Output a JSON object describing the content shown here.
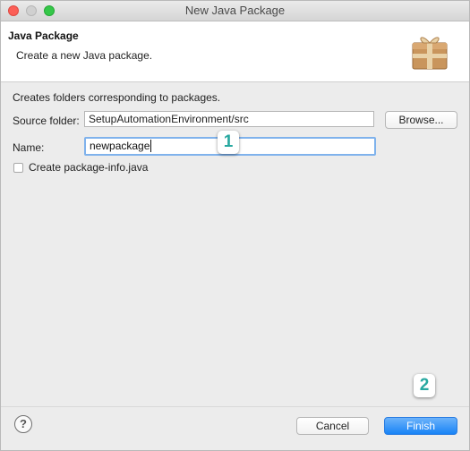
{
  "window": {
    "title": "New Java Package"
  },
  "header": {
    "title": "Java Package",
    "description": "Create a new Java package.",
    "icon": "package-icon"
  },
  "form": {
    "info": "Creates folders corresponding to packages.",
    "source_folder": {
      "label": "Source folder:",
      "value": "SetupAutomationEnvironment/src"
    },
    "browse_label": "Browse...",
    "name": {
      "label": "Name:",
      "value": "newpackage"
    },
    "package_info": {
      "label": "Create package-info.java",
      "checked": false
    }
  },
  "badges": {
    "step1": "1",
    "step2": "2"
  },
  "footer": {
    "help_glyph": "?",
    "cancel_label": "Cancel",
    "finish_label": "Finish"
  },
  "colors": {
    "accent": "#1883f6",
    "badge_text": "#27a8a0",
    "focus_ring": "#7fb2ec"
  }
}
